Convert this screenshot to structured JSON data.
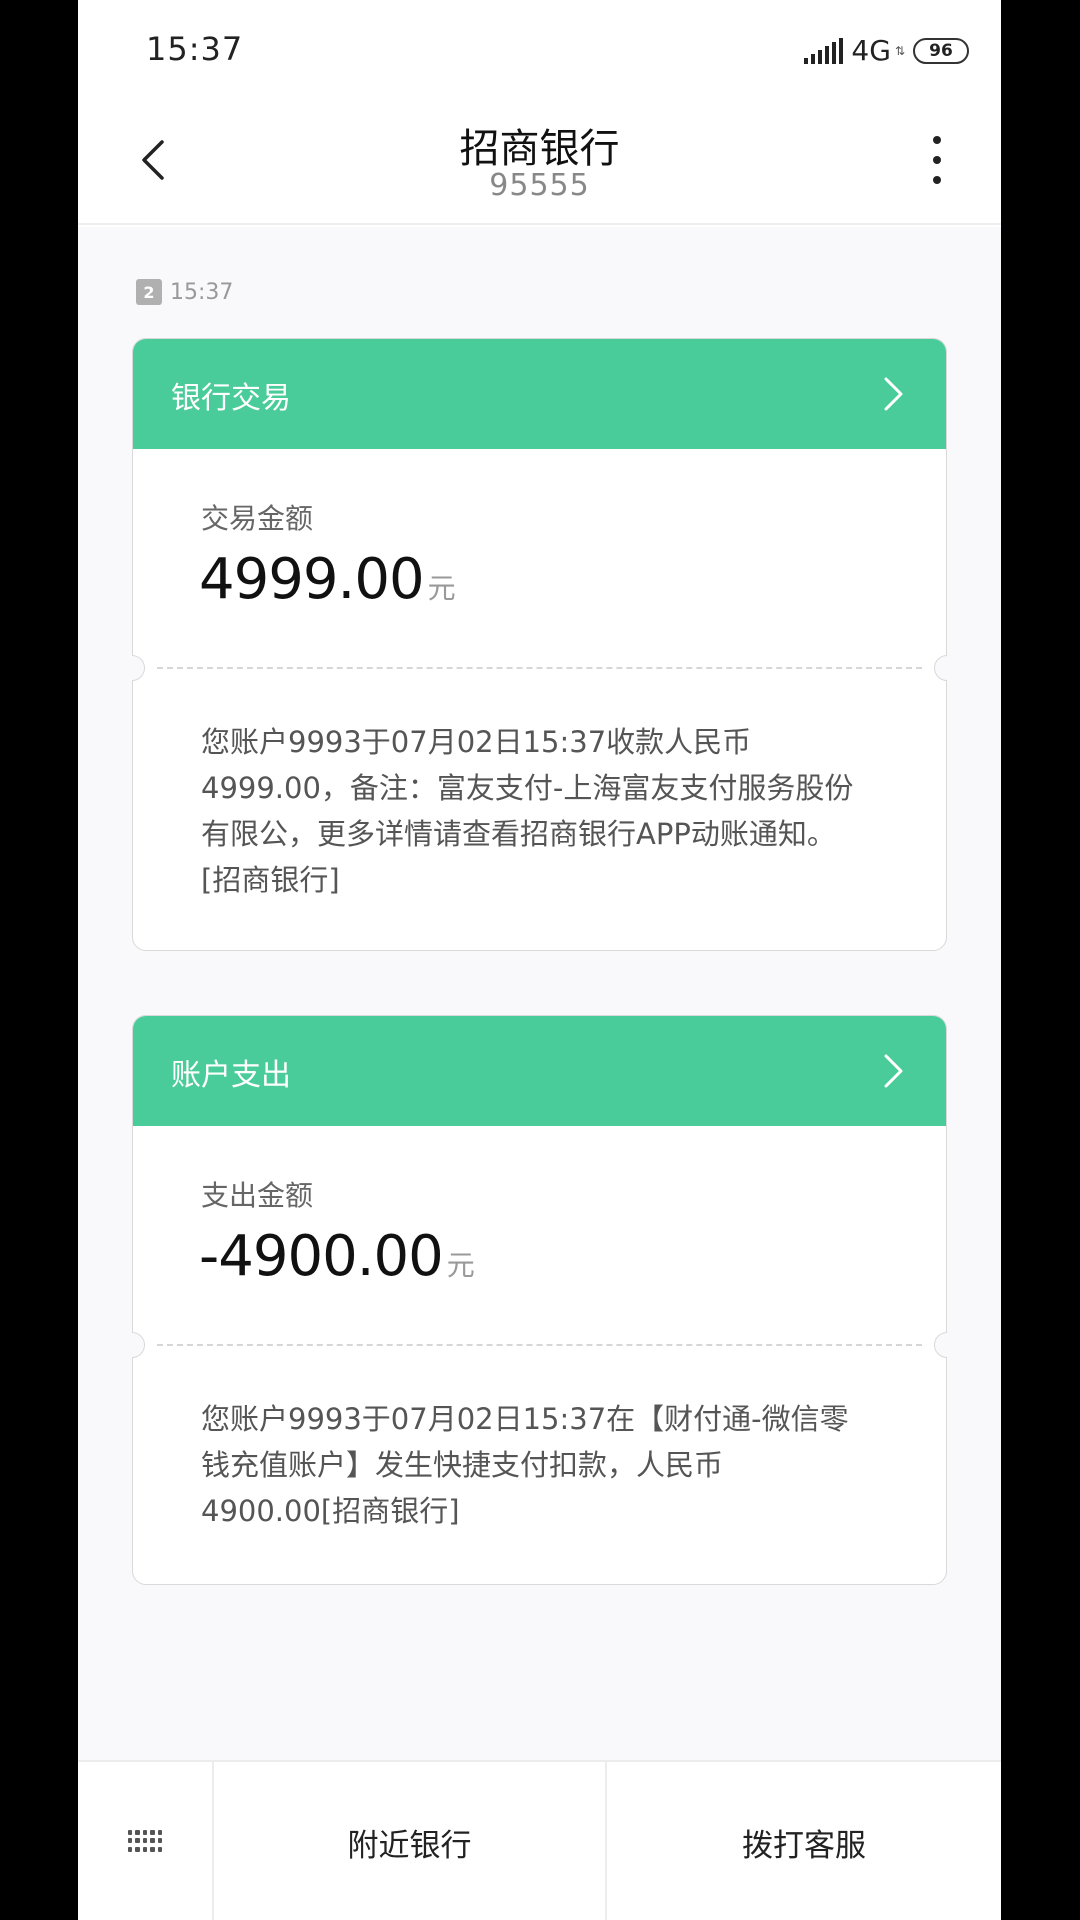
{
  "status_bar": {
    "time": "15:37",
    "network": "4G",
    "battery": "96"
  },
  "header": {
    "title": "招商银行",
    "number": "95555"
  },
  "thread": {
    "sim_slot": "2",
    "time": "15:37"
  },
  "cards": [
    {
      "header_label": "银行交易",
      "amount_label": "交易金额",
      "amount": "4999.00",
      "unit": "元",
      "text": "您账户9993于07月02日15:37收款人民币4999.00，备注：富友支付-上海富友支付服务股份有限公，更多详情请查看招商银行APP动账通知。[招商银行]"
    },
    {
      "header_label": "账户支出",
      "amount_label": "支出金额",
      "amount": "-4900.00",
      "unit": "元",
      "text": "您账户9993于07月02日15:37在【财付通-微信零钱充值账户】发生快捷支付扣款，人民币4900.00[招商银行]"
    }
  ],
  "bottom_bar": {
    "nearby_label": "附近银行",
    "call_label": "拨打客服"
  },
  "colors": {
    "card_header": "#49cc99",
    "background": "#f9f9fb"
  }
}
